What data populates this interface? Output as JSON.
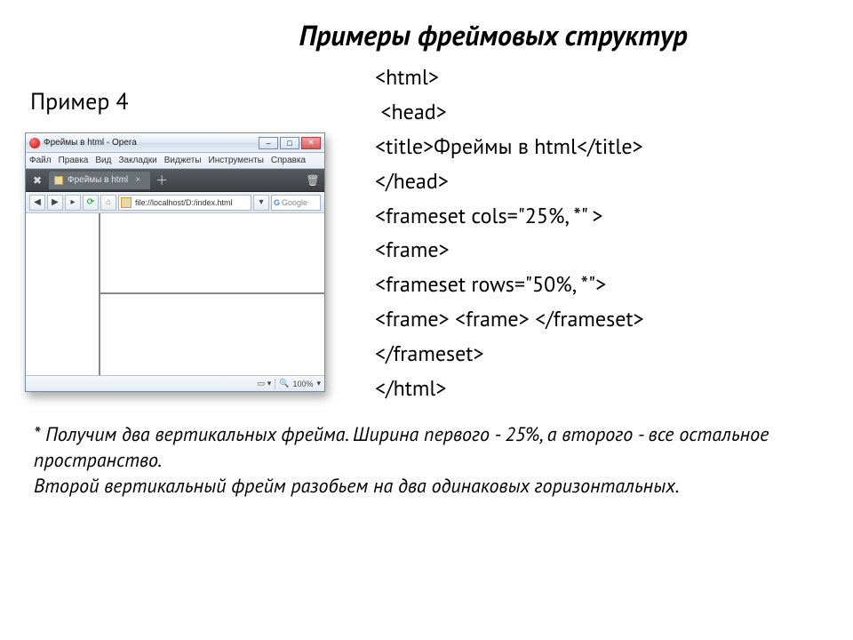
{
  "title": "Примеры фреймовых структур",
  "example_label": "Пример 4",
  "browser": {
    "window_title": "Фреймы в html - Opera",
    "menus": [
      "Файл",
      "Правка",
      "Вид",
      "Закладки",
      "Виджеты",
      "Инструменты",
      "Справка"
    ],
    "tab_label": "Фреймы в html",
    "address": "file://localhost/D:/index.html",
    "search_placeholder": "Google",
    "zoom": "100%"
  },
  "code": {
    "l1": "<html>",
    "l2": " <head>",
    "l3": "<title>Фреймы в html</title>",
    "l4": "</head>",
    "l5": "<frameset cols=\"25%, *\" >",
    "l6": "<frame>",
    "l7": "<frameset rows=\"50%, *\">",
    "l8": "<frame> <frame> </frameset>",
    "l9": "</frameset>",
    "l10": "</html>"
  },
  "footnote": {
    "p1": "* Получим два вертикальных фрейма. Ширина первого - 25%, а второго - все остальное пространство.",
    "p2": "Второй вертикальный фрейм разобьем на два одинаковых горизонтальных."
  }
}
